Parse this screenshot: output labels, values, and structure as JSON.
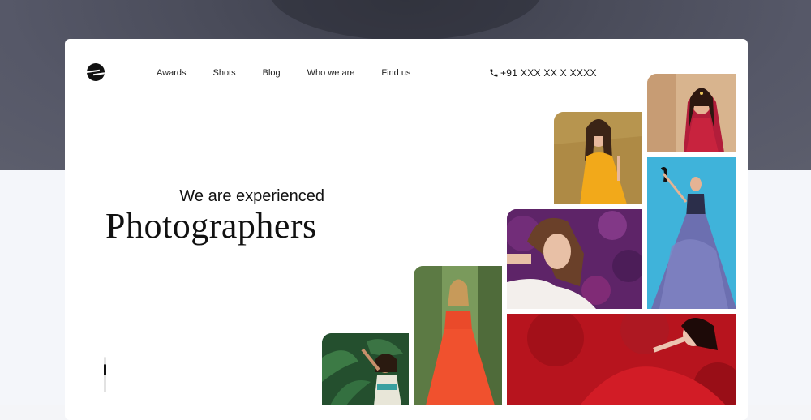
{
  "nav": {
    "items": [
      "Awards",
      "Shots",
      "Blog",
      "Who we are",
      "Find us"
    ]
  },
  "contact": {
    "phone": "+91 XXX XX X XXXX"
  },
  "hero": {
    "subtitle": "We are experienced",
    "title": "Photographers"
  },
  "icons": {
    "logo": "brand-logo",
    "phone": "phone-icon"
  },
  "colors": {
    "text": "#111111",
    "card": "#ffffff",
    "header_bg": "#4a4c5a"
  }
}
